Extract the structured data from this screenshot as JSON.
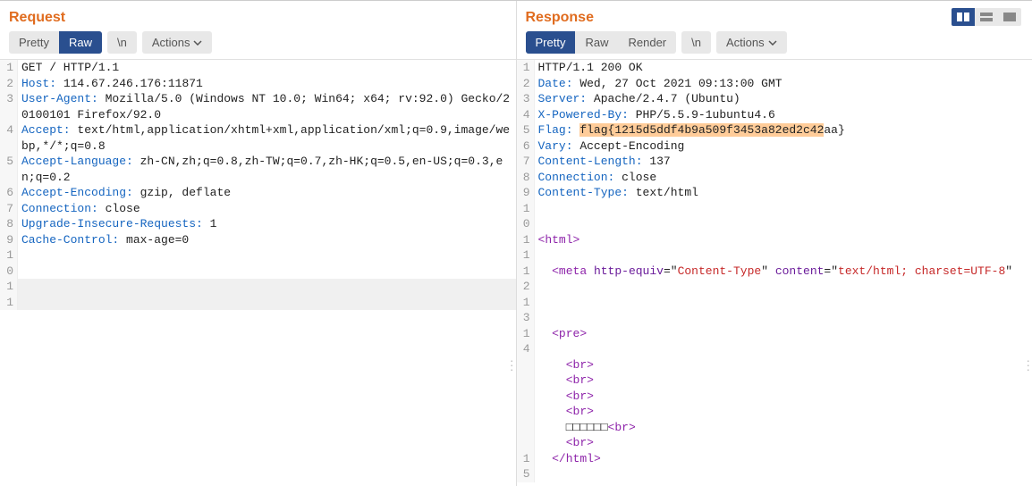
{
  "request": {
    "title": "Request",
    "tabs": {
      "pretty": "Pretty",
      "raw": "Raw"
    },
    "buttons": {
      "newline": "\\n",
      "actions": "Actions"
    },
    "active_tab": "raw",
    "lines": [
      {
        "n": "1",
        "segs": [
          {
            "t": "GET / HTTP/1.1",
            "c": ""
          }
        ]
      },
      {
        "n": "2",
        "segs": [
          {
            "t": "Host:",
            "c": "hl-header"
          },
          {
            "t": " 114.67.246.176:11871",
            "c": ""
          }
        ]
      },
      {
        "n": "3",
        "segs": [
          {
            "t": "User-Agent:",
            "c": "hl-header"
          },
          {
            "t": " Mozilla/5.0 (Windows NT 10.0; Win64; x64; rv:92.0) Gecko/20100101 Firefox/92.0",
            "c": ""
          }
        ]
      },
      {
        "n": "4",
        "segs": [
          {
            "t": "Accept:",
            "c": "hl-header"
          },
          {
            "t": " text/html,application/xhtml+xml,application/xml;q=0.9,image/webp,*/*;q=0.8",
            "c": ""
          }
        ]
      },
      {
        "n": "5",
        "segs": [
          {
            "t": "Accept-Language:",
            "c": "hl-header"
          },
          {
            "t": " zh-CN,zh;q=0.8,zh-TW;q=0.7,zh-HK;q=0.5,en-US;q=0.3,en;q=0.2",
            "c": ""
          }
        ]
      },
      {
        "n": "6",
        "segs": [
          {
            "t": "Accept-Encoding:",
            "c": "hl-header"
          },
          {
            "t": " gzip, deflate",
            "c": ""
          }
        ]
      },
      {
        "n": "7",
        "segs": [
          {
            "t": "Connection:",
            "c": "hl-header"
          },
          {
            "t": " close",
            "c": ""
          }
        ]
      },
      {
        "n": "8",
        "segs": [
          {
            "t": "Upgrade-Insecure-Requests:",
            "c": "hl-header"
          },
          {
            "t": " 1",
            "c": ""
          }
        ]
      },
      {
        "n": "9",
        "segs": [
          {
            "t": "Cache-Control:",
            "c": "hl-header"
          },
          {
            "t": " max-age=0",
            "c": ""
          }
        ]
      },
      {
        "n": "10",
        "segs": [
          {
            "t": "",
            "c": ""
          }
        ]
      },
      {
        "n": "11",
        "segs": [
          {
            "t": "",
            "c": ""
          }
        ],
        "current": true
      }
    ]
  },
  "response": {
    "title": "Response",
    "tabs": {
      "pretty": "Pretty",
      "raw": "Raw",
      "render": "Render"
    },
    "buttons": {
      "newline": "\\n",
      "actions": "Actions"
    },
    "active_tab": "pretty",
    "lines": [
      {
        "n": "1",
        "segs": [
          {
            "t": "HTTP/1.1 200 OK",
            "c": ""
          }
        ]
      },
      {
        "n": "2",
        "segs": [
          {
            "t": "Date:",
            "c": "hl-header"
          },
          {
            "t": " Wed, 27 Oct 2021 09:13:00 GMT",
            "c": ""
          }
        ]
      },
      {
        "n": "3",
        "segs": [
          {
            "t": "Server:",
            "c": "hl-header"
          },
          {
            "t": " Apache/2.4.7 (Ubuntu)",
            "c": ""
          }
        ]
      },
      {
        "n": "4",
        "segs": [
          {
            "t": "X-Powered-By:",
            "c": "hl-header"
          },
          {
            "t": " PHP/5.5.9-1ubuntu4.6",
            "c": ""
          }
        ]
      },
      {
        "n": "5",
        "segs": [
          {
            "t": "Flag:",
            "c": "hl-header"
          },
          {
            "t": " ",
            "c": ""
          },
          {
            "t": "flag{1215d5ddf4b9a509f3453a82ed2c42",
            "c": "hl-mark"
          },
          {
            "t": "aa}",
            "c": ""
          }
        ]
      },
      {
        "n": "6",
        "segs": [
          {
            "t": "Vary:",
            "c": "hl-header"
          },
          {
            "t": " Accept-Encoding",
            "c": ""
          }
        ]
      },
      {
        "n": "7",
        "segs": [
          {
            "t": "Content-Length:",
            "c": "hl-header"
          },
          {
            "t": " 137",
            "c": ""
          }
        ]
      },
      {
        "n": "8",
        "segs": [
          {
            "t": "Connection:",
            "c": "hl-header"
          },
          {
            "t": " close",
            "c": ""
          }
        ]
      },
      {
        "n": "9",
        "segs": [
          {
            "t": "Content-Type:",
            "c": "hl-header"
          },
          {
            "t": " text/html",
            "c": ""
          }
        ]
      },
      {
        "n": "10",
        "segs": [
          {
            "t": "",
            "c": ""
          }
        ]
      },
      {
        "n": "11",
        "segs": [
          {
            "t": "<",
            "c": "hl-tag"
          },
          {
            "t": "html",
            "c": "hl-tag"
          },
          {
            "t": ">",
            "c": "hl-tag"
          }
        ]
      },
      {
        "n": "12",
        "segs": [
          {
            "t": "  <",
            "c": "hl-tag"
          },
          {
            "t": "meta",
            "c": "hl-tag"
          },
          {
            "t": " ",
            "c": ""
          },
          {
            "t": "http-equiv",
            "c": "hl-attr"
          },
          {
            "t": "=\"",
            "c": ""
          },
          {
            "t": "Content-Type",
            "c": "hl-val"
          },
          {
            "t": "\" ",
            "c": ""
          },
          {
            "t": "content",
            "c": "hl-attr"
          },
          {
            "t": "=\"",
            "c": ""
          },
          {
            "t": "text/html; charset=UTF-8",
            "c": "hl-val"
          },
          {
            "t": "\"",
            "c": ""
          }
        ]
      },
      {
        "n": "13",
        "segs": [
          {
            "t": "",
            "c": ""
          }
        ]
      },
      {
        "n": "14",
        "segs": [
          {
            "t": "  <",
            "c": "hl-tag"
          },
          {
            "t": "pre",
            "c": "hl-tag"
          },
          {
            "t": ">",
            "c": "hl-tag"
          }
        ]
      },
      {
        "n": "",
        "segs": [
          {
            "t": "    <",
            "c": "hl-tag"
          },
          {
            "t": "br",
            "c": "hl-tag"
          },
          {
            "t": ">",
            "c": "hl-tag"
          }
        ]
      },
      {
        "n": "",
        "segs": [
          {
            "t": "    <",
            "c": "hl-tag"
          },
          {
            "t": "br",
            "c": "hl-tag"
          },
          {
            "t": ">",
            "c": "hl-tag"
          }
        ]
      },
      {
        "n": "",
        "segs": [
          {
            "t": "    <",
            "c": "hl-tag"
          },
          {
            "t": "br",
            "c": "hl-tag"
          },
          {
            "t": ">",
            "c": "hl-tag"
          }
        ]
      },
      {
        "n": "",
        "segs": [
          {
            "t": "    <",
            "c": "hl-tag"
          },
          {
            "t": "br",
            "c": "hl-tag"
          },
          {
            "t": ">",
            "c": "hl-tag"
          }
        ]
      },
      {
        "n": "",
        "segs": [
          {
            "t": "    □□□□□□",
            "c": ""
          },
          {
            "t": "<",
            "c": "hl-tag"
          },
          {
            "t": "br",
            "c": "hl-tag"
          },
          {
            "t": ">",
            "c": "hl-tag"
          }
        ]
      },
      {
        "n": "",
        "segs": [
          {
            "t": "    <",
            "c": "hl-tag"
          },
          {
            "t": "br",
            "c": "hl-tag"
          },
          {
            "t": ">",
            "c": "hl-tag"
          }
        ]
      },
      {
        "n": "15",
        "segs": [
          {
            "t": "  </",
            "c": "hl-tag"
          },
          {
            "t": "html",
            "c": "hl-tag"
          },
          {
            "t": ">",
            "c": "hl-tag"
          }
        ]
      }
    ]
  }
}
